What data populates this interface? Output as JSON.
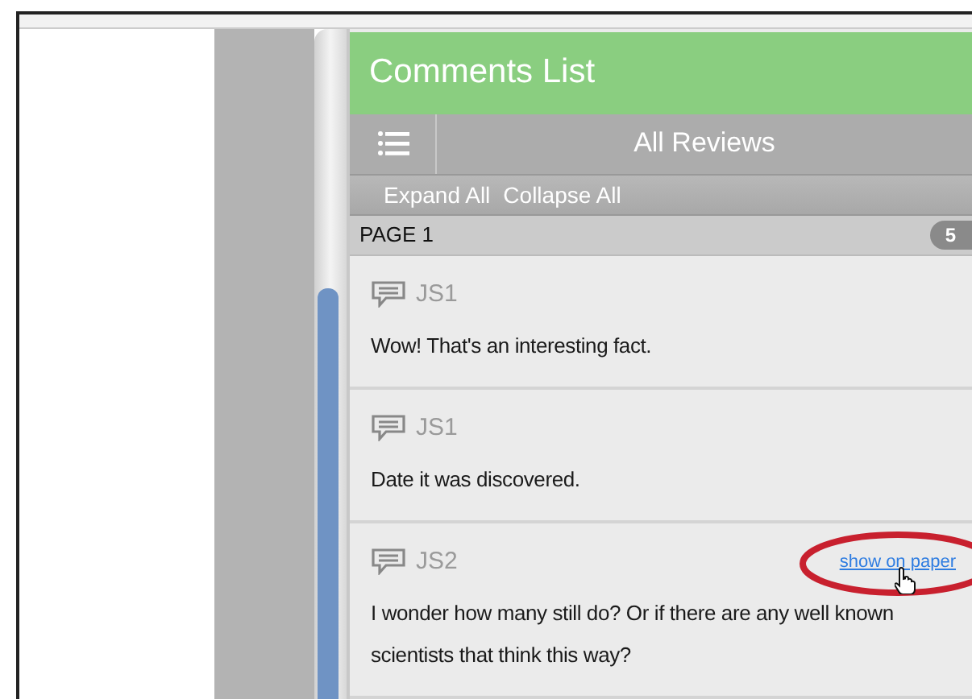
{
  "panel": {
    "title": "Comments List",
    "filter": "All Reviews",
    "actions": [
      "Expand All",
      "Collapse All"
    ]
  },
  "page_group": {
    "label": "PAGE 1",
    "count": "5"
  },
  "comments": [
    {
      "author": "JS1",
      "text": "Wow! That's an interesting fact."
    },
    {
      "author": "JS1",
      "text": "Date it was discovered."
    },
    {
      "author": "JS2",
      "text": "I wonder how many still do? Or if there are any well known scientists that think this way?",
      "link": "show on paper",
      "highlighted": true
    }
  ]
}
